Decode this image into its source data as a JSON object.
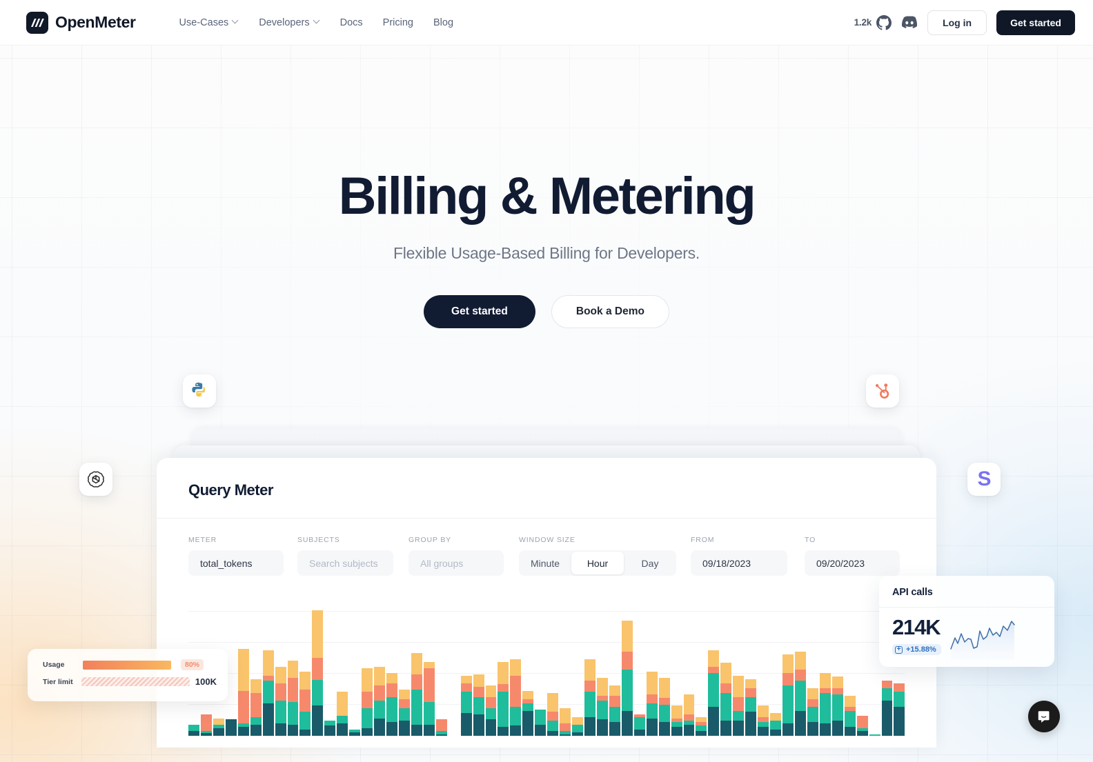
{
  "navbar": {
    "brand": "OpenMeter",
    "brand_icon": "openmeter-logo-icon",
    "links": [
      {
        "label": "Use-Cases",
        "has_dropdown": true
      },
      {
        "label": "Developers",
        "has_dropdown": true
      },
      {
        "label": "Docs",
        "has_dropdown": false
      },
      {
        "label": "Pricing",
        "has_dropdown": false
      },
      {
        "label": "Blog",
        "has_dropdown": false
      }
    ],
    "github_stars": "1.2k",
    "github_icon": "github-icon",
    "discord_icon": "discord-icon",
    "login_label": "Log in",
    "get_started_label": "Get started"
  },
  "hero": {
    "title": "Billing & Metering",
    "subtitle": "Flexible Usage-Based Billing for Developers.",
    "primary_cta": "Get started",
    "secondary_cta": "Book a Demo"
  },
  "floating_tiles": [
    {
      "name": "python-icon",
      "label": "Python"
    },
    {
      "name": "hubspot-icon",
      "label": "HubSpot"
    },
    {
      "name": "openai-icon",
      "label": "OpenAI"
    },
    {
      "name": "stripe-icon",
      "label": "S"
    }
  ],
  "panel": {
    "title": "Query Meter",
    "fields": {
      "meter": {
        "label": "METER",
        "value": "total_tokens"
      },
      "subjects": {
        "label": "SUBJECTS",
        "value": "",
        "placeholder": "Search subjects"
      },
      "group_by": {
        "label": "GROUP BY",
        "value": "",
        "placeholder": "All groups"
      },
      "window_size": {
        "label": "WINDOW SIZE",
        "options": [
          "Minute",
          "Hour",
          "Day"
        ],
        "selected": "Hour"
      },
      "from": {
        "label": "FROM",
        "value": "09/18/2023"
      },
      "to": {
        "label": "TO",
        "value": "09/20/2023"
      }
    }
  },
  "usage_card": {
    "usage_label": "Usage",
    "usage_percent": "80%",
    "tier_label": "Tier limit",
    "tier_value": "100K"
  },
  "api_card": {
    "title": "API calls",
    "value": "214K",
    "delta": "+15.88%",
    "delta_icon": "increase-icon",
    "sparkline_icon": "sparkline-chart"
  },
  "chat_widget": {
    "icon": "intercom-chat-icon"
  },
  "colors": {
    "brand_dark": "#111c33",
    "series_base": "#1a5b69",
    "series_green": "#1fbd9c",
    "series_salmon": "#f6896c",
    "series_amber": "#f9c46b",
    "accent_blue": "#2f6fbe",
    "accent_orange": "#f08c6d"
  },
  "chart_data": {
    "type": "bar",
    "title": "",
    "xlabel": "",
    "ylabel": "",
    "stacked": true,
    "grid": true,
    "legend": false,
    "ylim": [
      0,
      100
    ],
    "series": [
      {
        "name": "series-base",
        "color": "#1a5b69",
        "values": [
          4,
          2,
          6,
          13,
          7,
          9,
          26,
          10,
          9,
          5,
          25,
          8,
          10,
          3,
          6,
          14,
          11,
          12,
          9,
          9,
          1,
          0,
          18,
          17,
          13,
          7,
          8,
          20,
          9,
          4,
          1,
          3,
          15,
          13,
          11,
          20,
          5,
          14,
          11,
          7,
          9,
          4,
          23,
          12,
          12,
          19,
          7,
          5,
          10,
          20,
          11,
          10,
          12,
          7,
          4,
          0,
          28,
          23
        ]
      },
      {
        "name": "series-green",
        "color": "#1fbd9c",
        "values": [
          5,
          2,
          3,
          0,
          3,
          6,
          18,
          18,
          18,
          14,
          21,
          4,
          6,
          2,
          16,
          14,
          20,
          10,
          28,
          18,
          3,
          0,
          17,
          14,
          9,
          28,
          15,
          6,
          12,
          8,
          3,
          6,
          20,
          15,
          12,
          33,
          10,
          12,
          14,
          4,
          3,
          4,
          27,
          22,
          8,
          12,
          4,
          7,
          30,
          24,
          12,
          24,
          21,
          13,
          2,
          1,
          10,
          12
        ]
      },
      {
        "name": "series-salmon",
        "color": "#f6896c",
        "values": [
          0,
          13,
          0,
          0,
          26,
          19,
          4,
          14,
          19,
          18,
          18,
          0,
          0,
          0,
          13,
          12,
          11,
          7,
          12,
          27,
          9,
          0,
          7,
          8,
          9,
          6,
          25,
          3,
          0,
          7,
          6,
          0,
          9,
          4,
          9,
          14,
          2,
          7,
          5,
          3,
          5,
          3,
          5,
          8,
          11,
          7,
          4,
          0,
          10,
          9,
          6,
          4,
          5,
          3,
          10,
          0,
          6,
          7
        ]
      },
      {
        "name": "series-amber",
        "color": "#f9c46b",
        "values": [
          0,
          0,
          5,
          0,
          33,
          11,
          20,
          13,
          14,
          14,
          39,
          0,
          19,
          0,
          19,
          15,
          8,
          8,
          17,
          5,
          0,
          0,
          6,
          10,
          9,
          18,
          13,
          7,
          0,
          15,
          12,
          6,
          17,
          14,
          8,
          25,
          0,
          18,
          16,
          10,
          16,
          4,
          13,
          16,
          17,
          7,
          9,
          6,
          15,
          14,
          9,
          12,
          9,
          9,
          0,
          0,
          0,
          0
        ]
      }
    ]
  }
}
